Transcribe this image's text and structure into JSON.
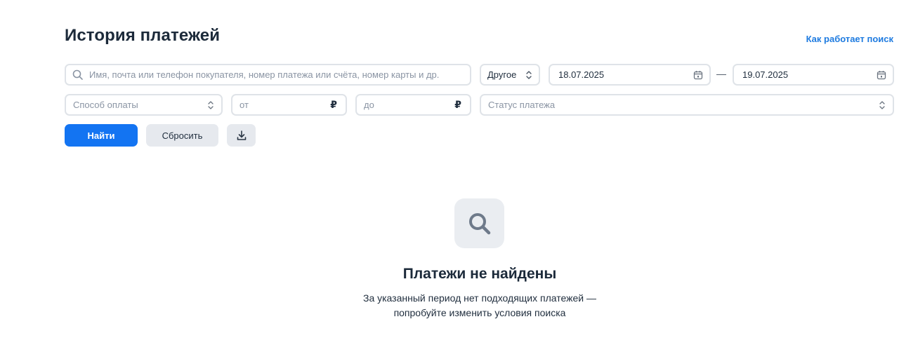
{
  "page": {
    "title": "История платежей",
    "help_link": "Как работает поиск"
  },
  "filters": {
    "search": {
      "placeholder": "Имя, почта или телефон покупателя, номер платежа или счёта, номер карты и др.",
      "icon": "search-icon"
    },
    "period": {
      "value": "Другое",
      "icon": "chevron-updown-icon"
    },
    "date_from": {
      "value": "18.07.2025",
      "icon": "calendar-icon"
    },
    "date_separator": "—",
    "date_to": {
      "value": "19.07.2025",
      "icon": "calendar-icon"
    },
    "payment_method": {
      "placeholder": "Способ оплаты",
      "icon": "chevron-updown-icon"
    },
    "amount_from": {
      "placeholder": "от",
      "currency": "₽"
    },
    "amount_to": {
      "placeholder": "до",
      "currency": "₽"
    },
    "payment_status": {
      "placeholder": "Статус платежа",
      "icon": "chevron-updown-icon"
    }
  },
  "actions": {
    "find_label": "Найти",
    "reset_label": "Сбросить",
    "download_icon": "download-icon"
  },
  "empty_state": {
    "icon": "search-icon",
    "title": "Платежи не найдены",
    "line1": "За указанный период нет подходящих платежей —",
    "line2": "попробуйте изменить условия поиска"
  },
  "colors": {
    "accent": "#1374f2",
    "link": "#1e7be0",
    "border": "#dfe3e8",
    "button_secondary": "#e6e9ee",
    "text": "#1c2a3a"
  }
}
